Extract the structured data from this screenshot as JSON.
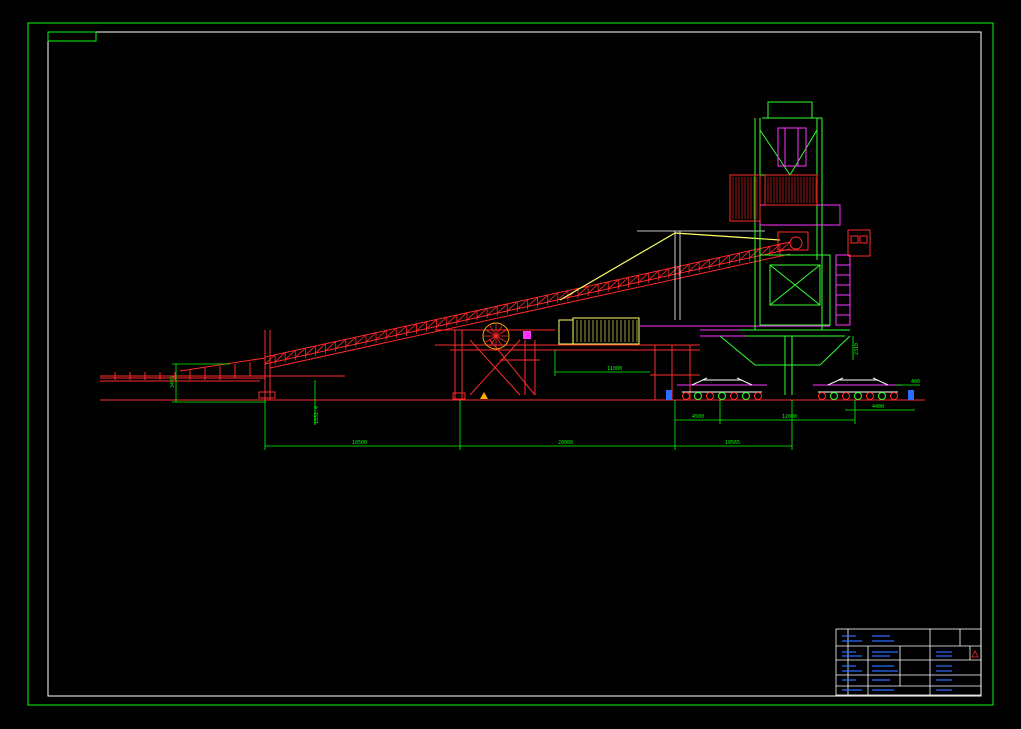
{
  "dimensions": {
    "horizontal": [
      {
        "id": "d-18500",
        "label": "18500"
      },
      {
        "id": "d-20000",
        "label": "20000"
      },
      {
        "id": "d-10565",
        "label": "10565"
      },
      {
        "id": "d-11080",
        "label": "11080"
      },
      {
        "id": "d-4500",
        "label": "4500"
      },
      {
        "id": "d-12000",
        "label": "12000"
      },
      {
        "id": "d-4400",
        "label": "4400"
      },
      {
        "id": "d-400",
        "label": "400"
      }
    ],
    "vertical": [
      {
        "id": "v-3495",
        "label": "3495"
      },
      {
        "id": "v-1832",
        "label": "1832.4"
      },
      {
        "id": "v-2310",
        "label": "2310"
      }
    ]
  },
  "colors": {
    "frame": "#00ff00",
    "inner_frame": "#ffffff",
    "conveyor": "#ff2a2a",
    "tower": "#33ff33",
    "magenta": "#ff33ff",
    "yellow": "#ffff66",
    "title_block": "#2b6bff"
  }
}
